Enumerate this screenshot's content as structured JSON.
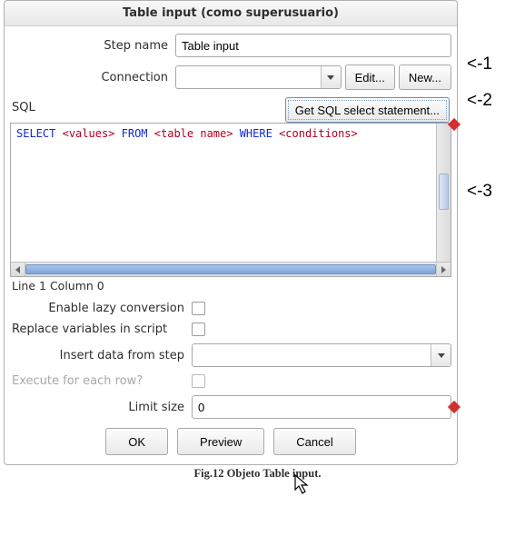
{
  "title": "Table input  (como superusuario)",
  "labels": {
    "step_name": "Step name",
    "connection": "Connection",
    "sql": "SQL",
    "cursor": "Line 1 Column 0",
    "lazy": "Enable lazy conversion",
    "replace": "Replace variables in script",
    "insert_from": "Insert data from step",
    "exec_each": "Execute for each row?",
    "limit": "Limit size"
  },
  "values": {
    "step_name": "Table input",
    "connection": "",
    "insert_from": "",
    "limit": "0"
  },
  "buttons": {
    "edit": "Edit...",
    "new": "New...",
    "get_sql": "Get SQL select statement...",
    "ok": "OK",
    "preview": "Preview",
    "cancel": "Cancel"
  },
  "sql": {
    "kw1": "SELECT",
    "ph1": "<values>",
    "kw2": "FROM",
    "ph2": "<table name>",
    "kw3": "WHERE",
    "ph3": "<conditions>"
  },
  "caption": "Fig.12 Objeto Table input.",
  "annotations": {
    "a1": "<-1",
    "a2": "<-2",
    "a3": "<-3"
  }
}
